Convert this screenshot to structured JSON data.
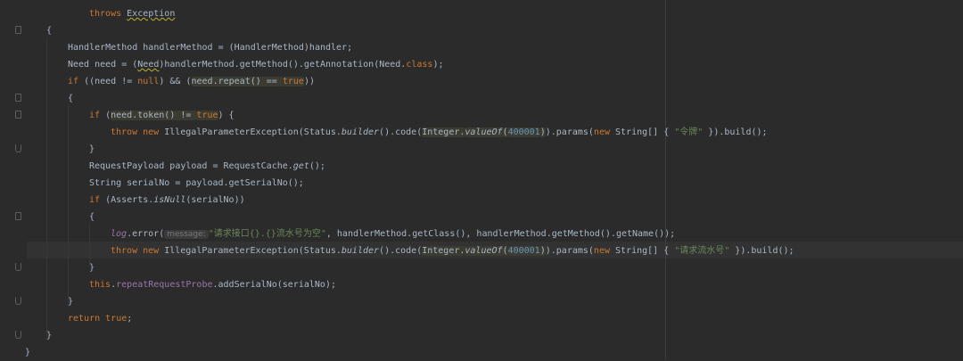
{
  "editor": {
    "partial_top": "",
    "lines": [
      {
        "indent": 6,
        "tokens": [
          [
            "kw",
            "throws"
          ],
          [
            "plain",
            " "
          ],
          [
            "cls",
            "Exception"
          ]
        ]
      },
      {
        "indent": 2,
        "tokens": [
          [
            "plain",
            "{"
          ]
        ]
      },
      {
        "indent": 4,
        "tokens": [
          [
            "plain",
            "HandlerMethod handlerMethod = (HandlerMethod)handler;"
          ]
        ]
      },
      {
        "indent": 4,
        "tokens": [
          [
            "plain",
            "Need need = ("
          ],
          [
            "warn",
            "Need"
          ],
          [
            "plain",
            ")handlerMethod.getMethod().getAnnotation(Need."
          ],
          [
            "kw",
            "class"
          ],
          [
            "plain",
            ");"
          ]
        ]
      },
      {
        "indent": 4,
        "tokens": [
          [
            "kw",
            "if"
          ],
          [
            "plain",
            " ((need != "
          ],
          [
            "kw",
            "null"
          ],
          [
            "plain",
            ") && ("
          ],
          [
            "hl",
            "need.repeat() == "
          ],
          [
            "hlkw",
            "true"
          ],
          [
            "plain",
            "))"
          ]
        ]
      },
      {
        "indent": 4,
        "tokens": [
          [
            "plain",
            "{"
          ]
        ]
      },
      {
        "indent": 6,
        "tokens": [
          [
            "kw",
            "if"
          ],
          [
            "plain",
            " ("
          ],
          [
            "hl",
            "need.token() != "
          ],
          [
            "hlkw",
            "true"
          ],
          [
            "plain",
            ") {"
          ]
        ]
      },
      {
        "indent": 8,
        "tokens": [
          [
            "kw",
            "throw new"
          ],
          [
            "plain",
            " IllegalParameterException(Status."
          ],
          [
            "it",
            "builder"
          ],
          [
            "plain",
            "().code("
          ],
          [
            "hl",
            "Integer."
          ],
          [
            "hlit",
            "valueOf"
          ],
          [
            "hl",
            "("
          ],
          [
            "hlnum",
            "400001"
          ],
          [
            "hl",
            ")"
          ],
          [
            "plain",
            ").params("
          ],
          [
            "kw",
            "new"
          ],
          [
            "plain",
            " String[] { "
          ],
          [
            "str",
            "\"令牌\""
          ],
          [
            "plain",
            " }).build();"
          ]
        ]
      },
      {
        "indent": 6,
        "tokens": [
          [
            "plain",
            "}"
          ]
        ]
      },
      {
        "indent": 6,
        "tokens": [
          [
            "plain",
            "RequestPayload payload = RequestCache."
          ],
          [
            "it",
            "get"
          ],
          [
            "plain",
            "();"
          ]
        ]
      },
      {
        "indent": 6,
        "tokens": [
          [
            "plain",
            "String serialNo = payload.getSerialNo();"
          ]
        ]
      },
      {
        "indent": 6,
        "tokens": [
          [
            "kw",
            "if"
          ],
          [
            "plain",
            " (Asserts."
          ],
          [
            "it",
            "isNull"
          ],
          [
            "plain",
            "(serialNo))"
          ]
        ]
      },
      {
        "indent": 6,
        "tokens": [
          [
            "plain",
            "{"
          ]
        ]
      },
      {
        "indent": 8,
        "tokens": [
          [
            "log",
            "log"
          ],
          [
            "plain",
            "."
          ],
          [
            "plain",
            "error("
          ],
          [
            "hint",
            "message:"
          ],
          [
            "str",
            "\"请求接口{}.{}流水号为空\""
          ],
          [
            "plain",
            ", handlerMethod.getClass(), handlerMethod.getMethod().getName());"
          ]
        ]
      },
      {
        "indent": 8,
        "tokens": [
          [
            "kw",
            "throw new"
          ],
          [
            "plain",
            " IllegalParameterException(Status."
          ],
          [
            "it",
            "builder"
          ],
          [
            "plain",
            "().code("
          ],
          [
            "hl",
            "Integer."
          ],
          [
            "hlit",
            "valueOf"
          ],
          [
            "hl",
            "("
          ],
          [
            "hlnum",
            "400001"
          ],
          [
            "hl",
            ")"
          ],
          [
            "plain",
            ").params("
          ],
          [
            "kw",
            "new"
          ],
          [
            "plain",
            " String[] { "
          ],
          [
            "str",
            "\"请求流水号\""
          ],
          [
            "plain",
            " }).build();"
          ]
        ]
      },
      {
        "indent": 6,
        "tokens": [
          [
            "plain",
            "}"
          ]
        ]
      },
      {
        "indent": 6,
        "tokens": [
          [
            "kw",
            "this"
          ],
          [
            "plain",
            "."
          ],
          [
            "fld",
            "repeatRequestProbe"
          ],
          [
            "plain",
            ".addSerialNo(serialNo);"
          ]
        ]
      },
      {
        "indent": 4,
        "tokens": [
          [
            "plain",
            "}"
          ]
        ]
      },
      {
        "indent": 4,
        "tokens": [
          [
            "kw",
            "return"
          ],
          [
            "plain",
            " "
          ],
          [
            "kw",
            "true"
          ],
          [
            "plain",
            ";"
          ]
        ]
      },
      {
        "indent": 2,
        "tokens": [
          [
            "plain",
            "}"
          ]
        ]
      },
      {
        "indent": 0,
        "tokens": [
          [
            "plain",
            "}"
          ]
        ]
      }
    ]
  },
  "colors": {
    "background": "#2b2b2b",
    "keyword": "#cc7832",
    "string": "#6a8759",
    "number": "#6897bb",
    "field": "#9876aa",
    "text": "#a9b7c6"
  }
}
